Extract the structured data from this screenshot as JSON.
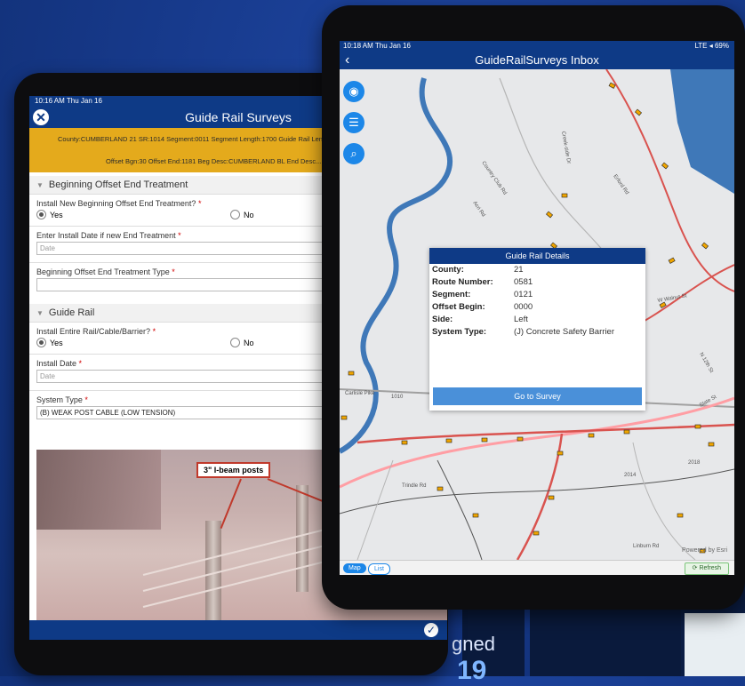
{
  "background": {
    "text_partial": "gned",
    "big_partial": "19"
  },
  "left_app": {
    "status_time": "10:16 AM  Thu Jan 16",
    "title": "Guide Rail Surveys",
    "info_line1": "County:CUMBERLAND 21 SR:1014 Segment:0011 Segment Length:1700 Guide Rail Len...",
    "info_line2": "Offset Bgn:30 Offset End:1181 Beg Desc:CUMBERLAND BL End Desc...",
    "section1": "Beginning Offset End Treatment",
    "q1": "Install New Beginning Offset End Treatment?",
    "opt_yes": "Yes",
    "opt_no": "No",
    "q2": "Enter Install Date if new End Treatment",
    "date_placeholder": "Date",
    "q3": "Beginning Offset End Treatment Type",
    "section2": "Guide Rail",
    "q4": "Install Entire Rail/Cable/Barrier?",
    "q5": "Install Date",
    "q6": "System Type",
    "system_type_value": "(B) WEAK POST CABLE (LOW TENSION)",
    "photo_callout": "3\" I-beam posts"
  },
  "right_app": {
    "status_time": "10:18 AM  Thu Jan 16",
    "status_right": "LTE ◂ 69%",
    "title": "GuideRailSurveys Inbox",
    "popup": {
      "header": "Guide Rail Details",
      "rows": [
        {
          "k": "County:",
          "v": "21"
        },
        {
          "k": "Route Number:",
          "v": "0581"
        },
        {
          "k": "Segment:",
          "v": "0121"
        },
        {
          "k": "Offset Begin:",
          "v": "0000"
        },
        {
          "k": "Side:",
          "v": "Left"
        },
        {
          "k": "System Type:",
          "v": "(J) Concrete Safety Barrier"
        }
      ],
      "button": "Go to Survey"
    },
    "map_labels": {
      "l1": "Country Club Rd",
      "l2": "Creek-side Dr",
      "l3": "Erford Rd",
      "l4": "Acri Rd",
      "l5": "Carlisle Pike",
      "l6": "1010",
      "l7": "W Walnut St",
      "l8": "Trindle Rd",
      "l9": "2014",
      "l10": "2018",
      "l11": "N 12th St",
      "l12": "Slate St",
      "l13": "Linburn Rd"
    },
    "powered_by": "Powered by Esri",
    "seg_map": "Map",
    "seg_list": "List",
    "refresh": "Refresh"
  },
  "colors": {
    "brand": "#0e3a86",
    "accent": "#1c87e8",
    "info_bar": "#e4aa1c"
  }
}
